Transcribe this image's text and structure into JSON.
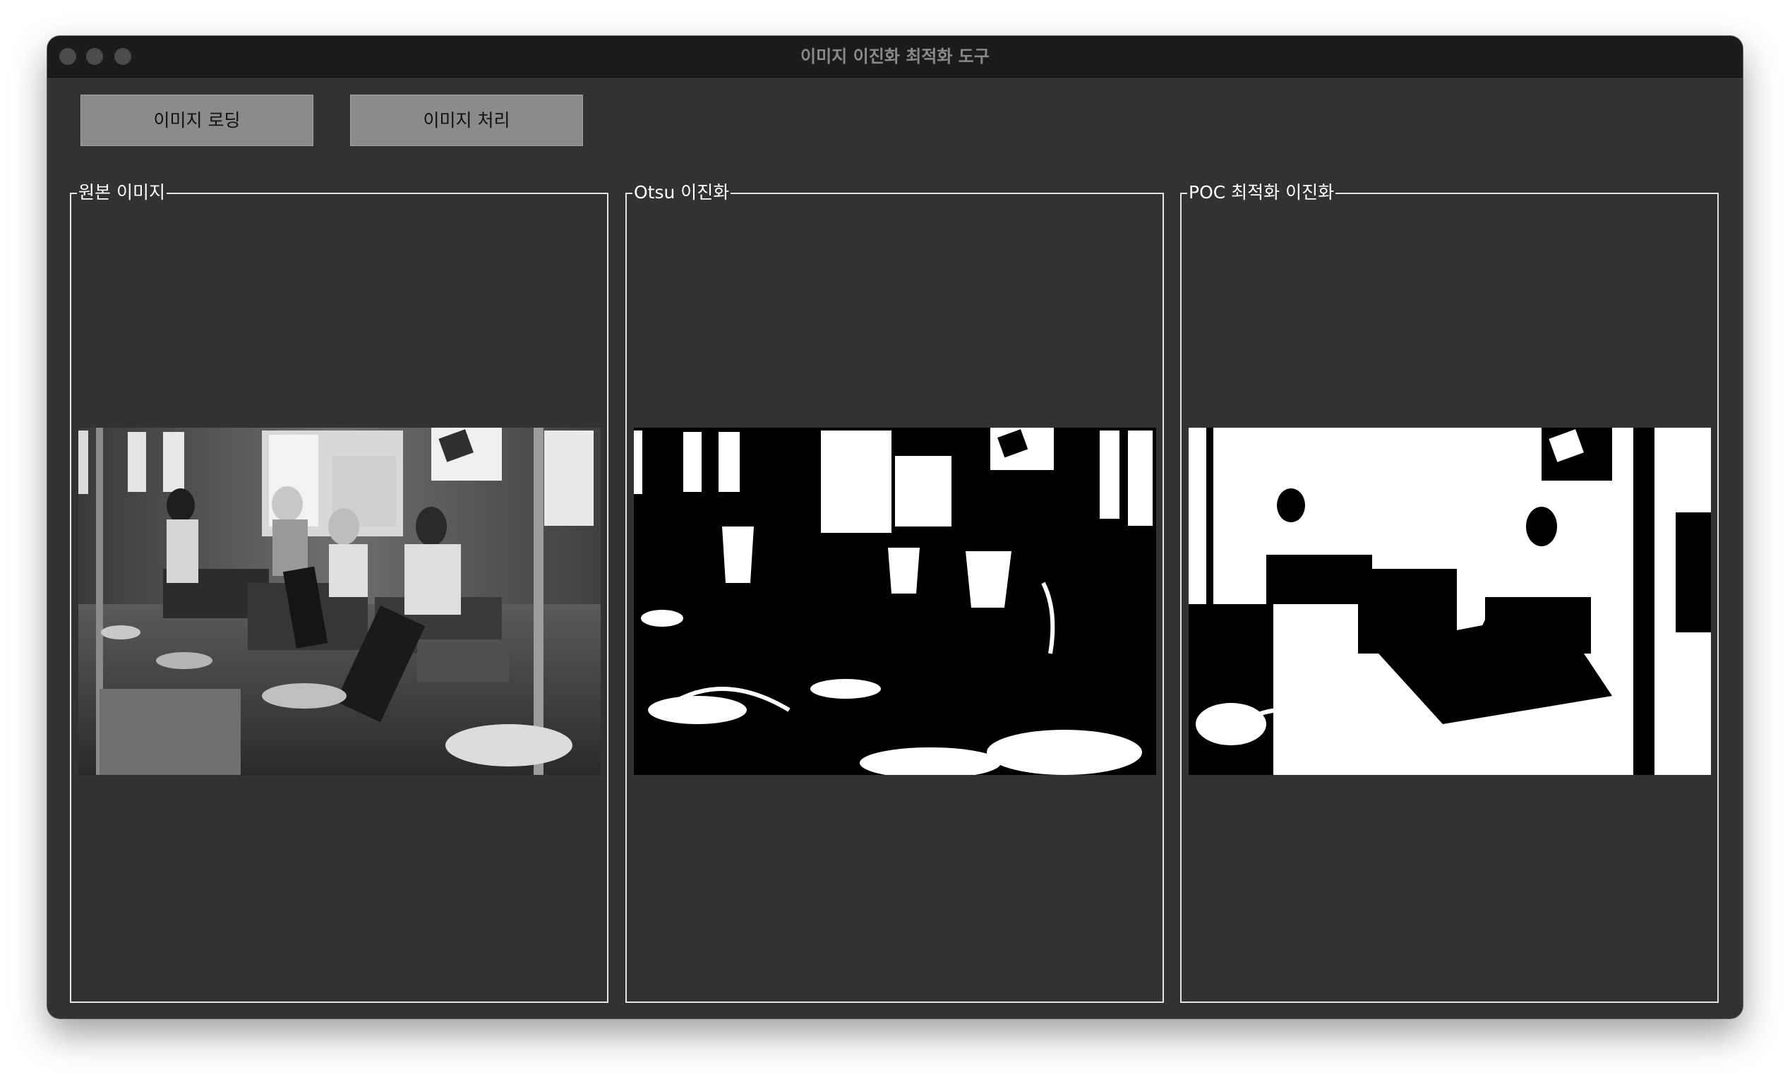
{
  "window": {
    "title": "이미지 이진화 최적화 도구"
  },
  "toolbar": {
    "load_label": "이미지 로딩",
    "process_label": "이미지 처리"
  },
  "panels": [
    {
      "label": "원본 이미지",
      "image_icon": "subway-photo-grayscale"
    },
    {
      "label": "Otsu 이진화",
      "image_icon": "subway-photo-otsu-binary"
    },
    {
      "label": "POC 최적화 이진화",
      "image_icon": "subway-photo-poc-binary"
    }
  ],
  "colors": {
    "window_bg": "#323232",
    "titlebar_bg": "#1b1b1b",
    "button_bg": "#8b8b8b",
    "panel_border": "#e6e6e6"
  }
}
